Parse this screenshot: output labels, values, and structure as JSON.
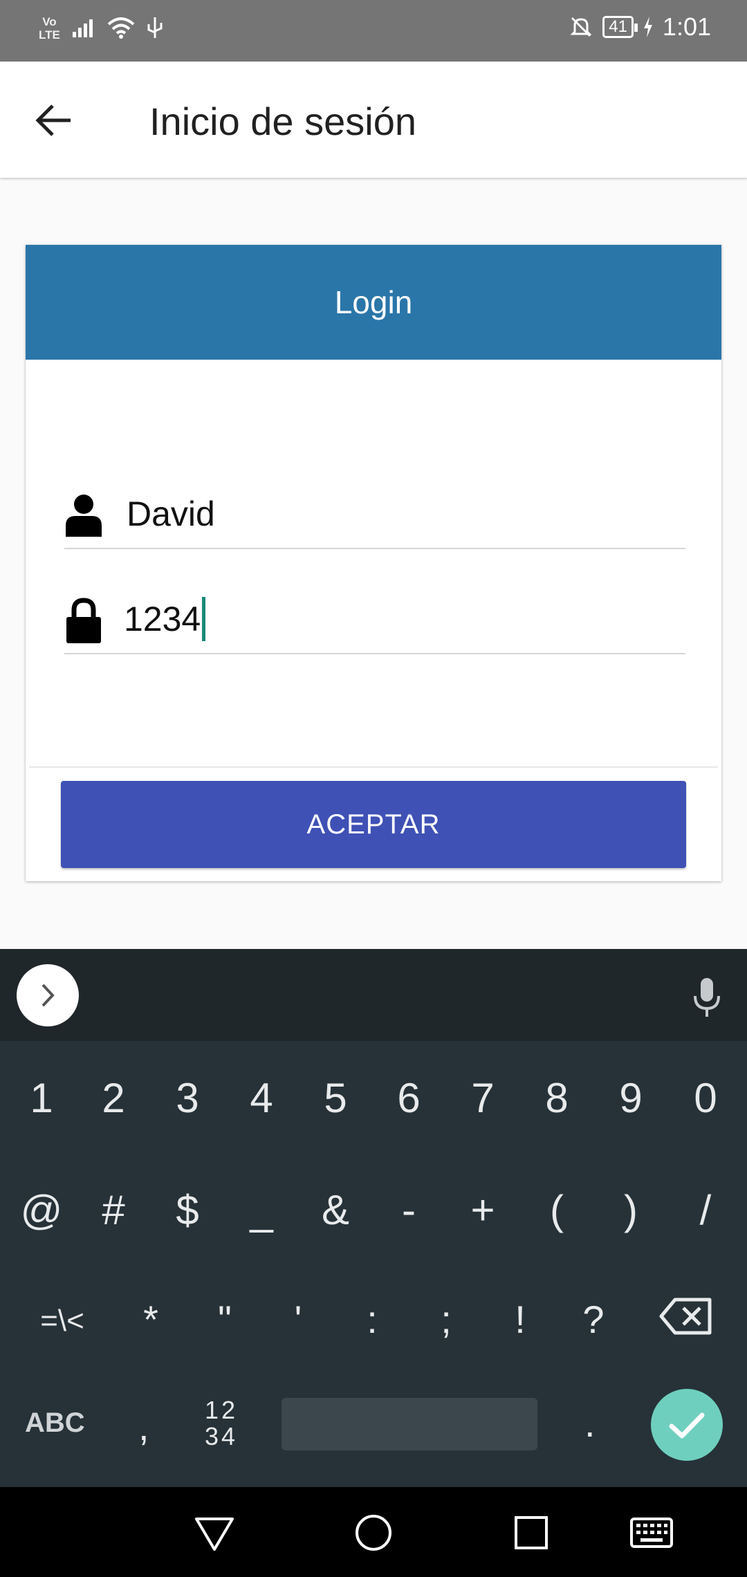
{
  "status_bar": {
    "network": "Vo\nLTE",
    "battery": "41",
    "time": "1:01"
  },
  "app_bar": {
    "title": "Inicio de sesión",
    "back_icon": "arrow-left-icon"
  },
  "login_card": {
    "header": "Login",
    "username": {
      "icon": "person-icon",
      "value": "David"
    },
    "password": {
      "icon": "lock-icon",
      "value": "1234"
    },
    "accept_label": "ACEPTAR",
    "header_color": "#2a76a9",
    "button_color": "#3f51b5"
  },
  "keyboard": {
    "row1": [
      "1",
      "2",
      "3",
      "4",
      "5",
      "6",
      "7",
      "8",
      "9",
      "0"
    ],
    "row2": [
      "@",
      "#",
      "$",
      "_",
      "&",
      "-",
      "+",
      "(",
      ")",
      "/"
    ],
    "row3": [
      "=\\<",
      "*",
      "\"",
      "'",
      ":",
      ";",
      "!",
      "?"
    ],
    "abc": "ABC",
    "comma": ",",
    "numpad_top": "12",
    "numpad_bottom": "34",
    "period": ".",
    "enter_color": "#6fcfbf"
  },
  "nav_bar": {
    "icons": [
      "back-triangle-icon",
      "home-circle-icon",
      "recents-square-icon",
      "keyboard-icon"
    ]
  }
}
